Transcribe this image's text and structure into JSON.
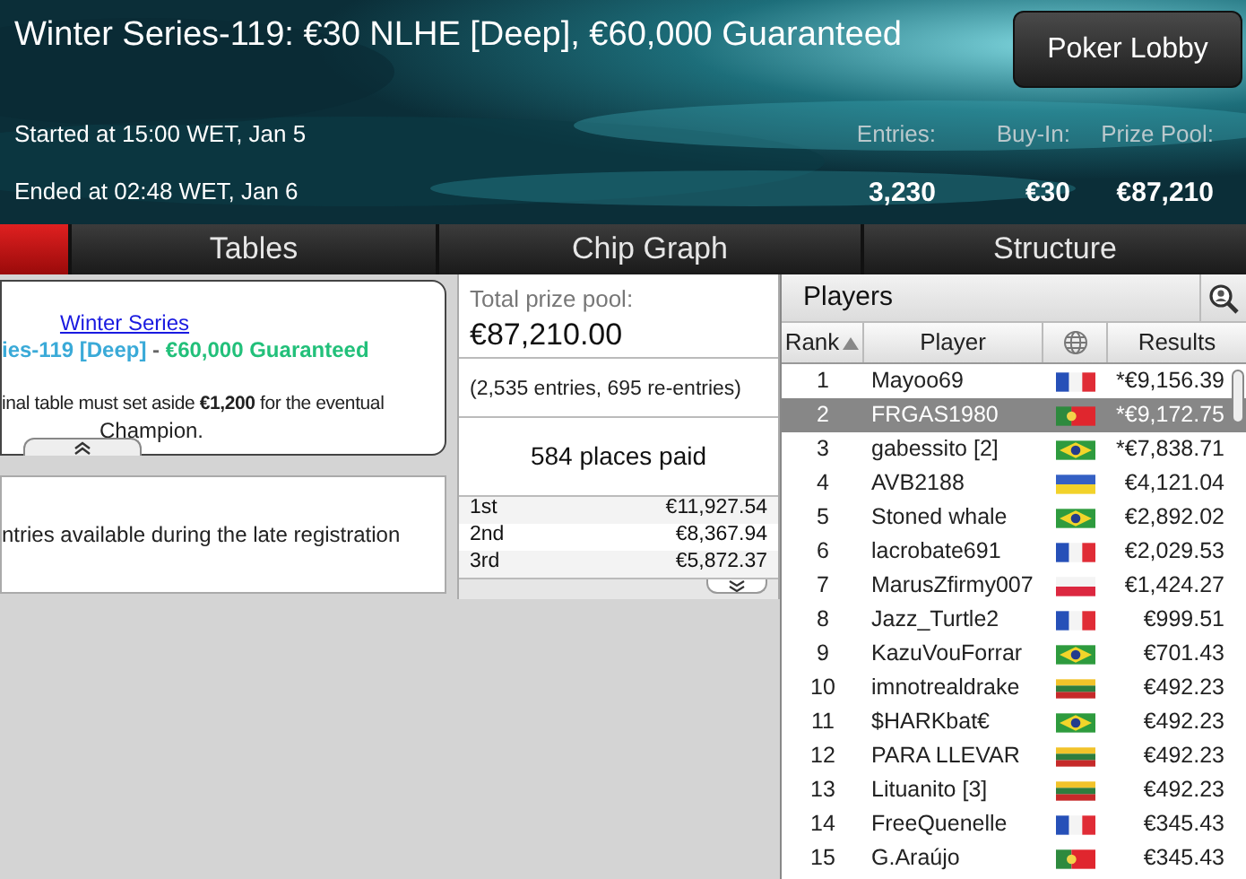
{
  "header": {
    "title": "Winter Series-119: €30 NLHE [Deep], €60,000 Guaranteed",
    "lobby_button": "Poker Lobby",
    "started": "Started at 15:00 WET, Jan 5",
    "ended": "Ended at 02:48 WET, Jan 6",
    "stats": [
      {
        "label": "Entries:",
        "value": "3,230"
      },
      {
        "label": "Buy-In:",
        "value": "€30"
      },
      {
        "label": "Prize Pool:",
        "value": "€87,210"
      }
    ]
  },
  "tabs": [
    {
      "selected": true
    },
    {
      "label": "Tables",
      "selected": false
    },
    {
      "label": "Chip Graph",
      "selected": false
    },
    {
      "label": "Structure",
      "selected": false
    }
  ],
  "info_card": {
    "link": "Winter Series",
    "name": "ies-119 [Deep]",
    "separator": " - ",
    "guarantee": "€60,000 Guaranteed",
    "note": "inal table must set aside **€1,200** for the eventual",
    "note_end": "Champion."
  },
  "reentry_card": {
    "text": "ntries available during the late registration"
  },
  "prize": {
    "label": "Total prize pool:",
    "amount": "€87,210.00",
    "entries": "(2,535 entries, 695 re-entries)",
    "places": "584 places paid",
    "payouts": [
      {
        "place": "1st",
        "amount": "€11,927.54"
      },
      {
        "place": "2nd",
        "amount": "€8,367.94"
      },
      {
        "place": "3rd",
        "amount": "€5,872.37"
      }
    ]
  },
  "players": {
    "title": "Players",
    "columns": [
      "Rank",
      "Player",
      "Results"
    ],
    "rows": [
      {
        "rank": "1",
        "player": "Mayoo69",
        "kind": "france",
        "result": "*€9,156.39",
        "selected": false
      },
      {
        "rank": "2",
        "player": "FRGAS1980",
        "kind": "portugal",
        "result": "*€9,172.75",
        "selected": true
      },
      {
        "rank": "3",
        "player": "gabessito [2]",
        "kind": "brazil",
        "result": "*€7,838.71",
        "selected": false
      },
      {
        "rank": "4",
        "player": "AVB2188",
        "kind": "ukraine",
        "result": "€4,121.04",
        "selected": false
      },
      {
        "rank": "5",
        "player": "Stoned whale",
        "kind": "brazil",
        "result": "€2,892.02",
        "selected": false
      },
      {
        "rank": "6",
        "player": "lacrobate691",
        "kind": "france",
        "result": "€2,029.53",
        "selected": false
      },
      {
        "rank": "7",
        "player": "MarusZfirmy007",
        "kind": "poland",
        "result": "€1,424.27",
        "selected": false
      },
      {
        "rank": "8",
        "player": "Jazz_Turtle2",
        "kind": "france",
        "result": "€999.51",
        "selected": false
      },
      {
        "rank": "9",
        "player": "KazuVouForrar",
        "kind": "brazil",
        "result": "€701.43",
        "selected": false
      },
      {
        "rank": "10",
        "player": "imnotrealdrake",
        "kind": "lithuania",
        "result": "€492.23",
        "selected": false
      },
      {
        "rank": "11",
        "player": "$HARKbat€",
        "kind": "brazil",
        "result": "€492.23",
        "selected": false
      },
      {
        "rank": "12",
        "player": "PARA LLEVAR",
        "kind": "lithuania",
        "result": "€492.23",
        "selected": false
      },
      {
        "rank": "13",
        "player": "Lituanito [3]",
        "kind": "lithuania",
        "result": "€492.23",
        "selected": false
      },
      {
        "rank": "14",
        "player": "FreeQuenelle",
        "kind": "france",
        "result": "€345.43",
        "selected": false
      },
      {
        "rank": "15",
        "player": "G.Araújo",
        "kind": "portugal",
        "result": "€345.43",
        "selected": false
      }
    ]
  }
}
